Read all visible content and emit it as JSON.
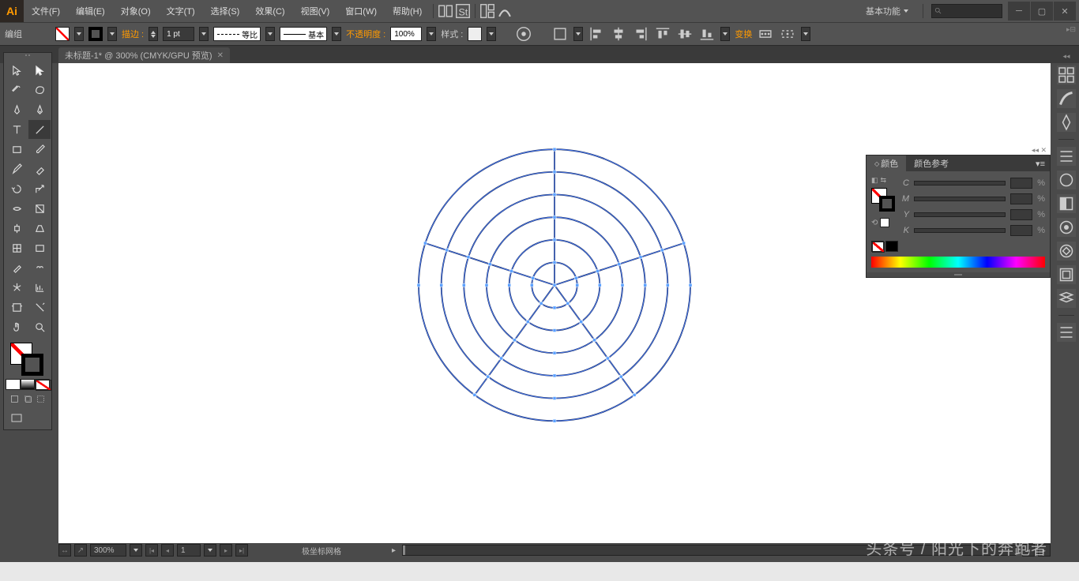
{
  "menu": {
    "items": [
      "文件(F)",
      "编辑(E)",
      "对象(O)",
      "文字(T)",
      "选择(S)",
      "效果(C)",
      "视图(V)",
      "窗口(W)",
      "帮助(H)"
    ]
  },
  "workspace": "基本功能",
  "ctrl": {
    "mode": "编组",
    "stroke_label": "描边 :",
    "stroke_w": "1 pt",
    "dash_label": "等比",
    "profile_label": "基本",
    "opacity_label": "不透明度 :",
    "opacity": "100%",
    "style_label": "样式 :",
    "transform_label": "变换"
  },
  "tab": {
    "title": "未标题-1* @ 300% (CMYK/GPU 预览)"
  },
  "panel": {
    "tabs": [
      "颜色",
      "颜色参考"
    ],
    "channels": [
      "C",
      "M",
      "Y",
      "K"
    ],
    "pct": "%"
  },
  "status": {
    "zoom": "300%",
    "page": "1",
    "tool": "极坐标网格"
  },
  "grid": {
    "rings": 6,
    "spokes": 5,
    "radius": 172
  },
  "watermark": "头条号 / 阳光下的奔跑者"
}
